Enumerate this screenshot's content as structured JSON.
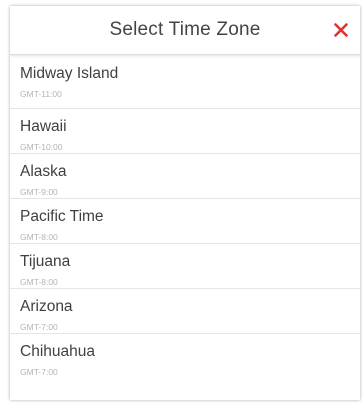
{
  "dialog": {
    "title": "Select Time Zone",
    "close_icon": "close-icon",
    "close_color": "#e0332f"
  },
  "timezones": [
    {
      "name": "Midway Island",
      "offset": "GMT-11:00"
    },
    {
      "name": "Hawaii",
      "offset": "GMT-10:00"
    },
    {
      "name": "Alaska",
      "offset": "GMT-9:00"
    },
    {
      "name": "Pacific Time",
      "offset": "GMT-8:00"
    },
    {
      "name": "Tijuana",
      "offset": "GMT-8:00"
    },
    {
      "name": "Arizona",
      "offset": "GMT-7:00"
    },
    {
      "name": "Chihuahua",
      "offset": "GMT-7:00"
    }
  ]
}
